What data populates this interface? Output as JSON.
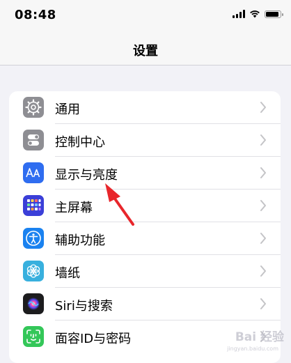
{
  "status_bar": {
    "time": "08:48",
    "battery_level": 0.9
  },
  "header": {
    "title": "设置"
  },
  "settings": {
    "items": [
      {
        "label": "通用",
        "icon": "gear-icon",
        "color": "#8e8e93"
      },
      {
        "label": "控制中心",
        "icon": "toggles-icon",
        "color": "#8e8e93"
      },
      {
        "label": "显示与亮度",
        "icon": "text-size-icon",
        "color": "#2f6df0"
      },
      {
        "label": "主屏幕",
        "icon": "home-grid-icon",
        "color": "#3b3fd8"
      },
      {
        "label": "辅助功能",
        "icon": "accessibility-icon",
        "color": "#1a82f0"
      },
      {
        "label": "墙纸",
        "icon": "flower-icon",
        "color": "#38b0de"
      },
      {
        "label": "Siri与搜索",
        "icon": "siri-icon",
        "color": "#1c1c1e"
      },
      {
        "label": "面容ID与密码",
        "icon": "face-id-icon",
        "color": "#34c759"
      }
    ]
  },
  "watermark": {
    "text": "Bai 经验",
    "sub": "jingyan.baidu.com"
  }
}
